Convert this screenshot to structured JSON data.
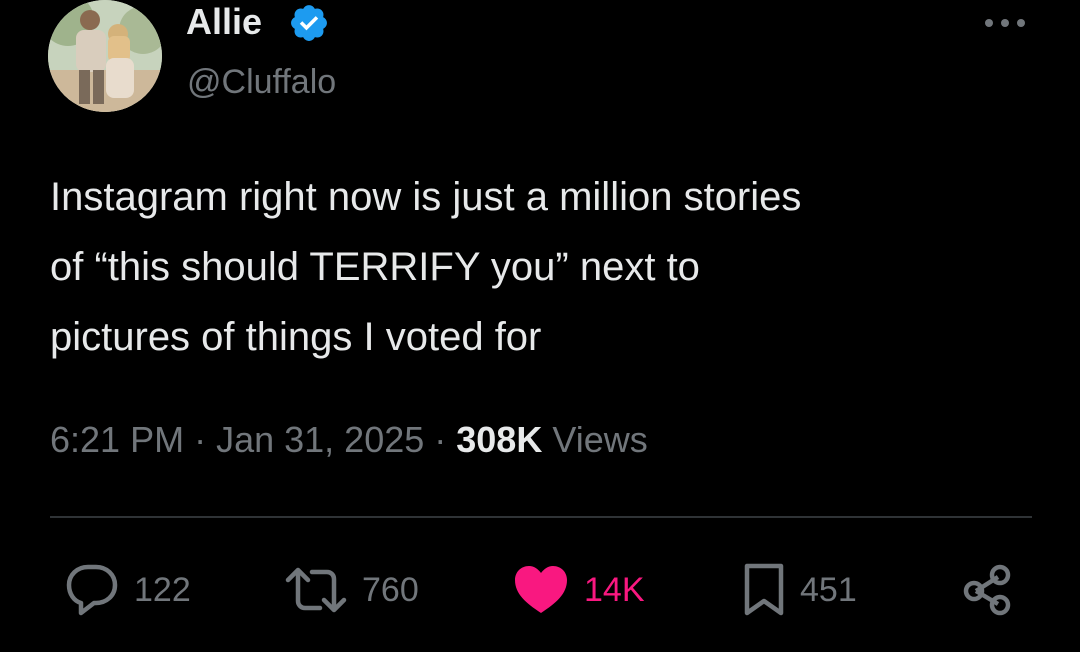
{
  "author": {
    "display_name": "Allie",
    "handle": "@Cluffalo",
    "verified": true
  },
  "tweet": {
    "text": "Instagram right now is just a million stories\nof “this should TERRIFY you” next to\npictures of things I voted for",
    "time": "6:21 PM",
    "separator": " · ",
    "date": "Jan 31, 2025",
    "views_count": "308K",
    "views_label": " Views"
  },
  "actions": {
    "replies": "122",
    "reposts": "760",
    "likes": "14K",
    "bookmarks": "451"
  },
  "icons": {
    "more": "more-dots-icon",
    "reply": "reply-bubble-icon",
    "repost": "repost-arrows-icon",
    "like": "heart-icon",
    "bookmark": "bookmark-icon",
    "share": "share-icon"
  },
  "colors": {
    "background": "#000000",
    "text": "#e7e9ea",
    "secondary_text": "#71767b",
    "verified_blue": "#1d9bf0",
    "like_pink": "#f91880",
    "divider": "#2f3336"
  }
}
